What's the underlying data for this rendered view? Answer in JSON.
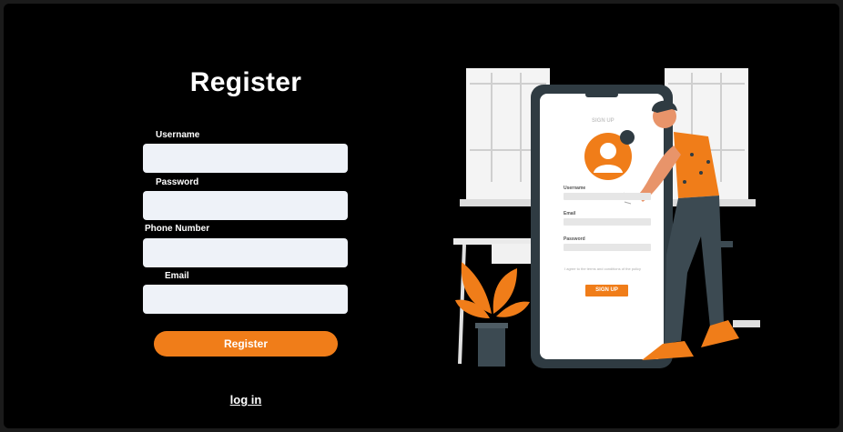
{
  "page_title": "Register",
  "form": {
    "fields": [
      {
        "label": "Username",
        "value": "",
        "placeholder": ""
      },
      {
        "label": "Password",
        "value": "",
        "placeholder": ""
      },
      {
        "label": "Phone Number",
        "value": "",
        "placeholder": ""
      },
      {
        "label": "Email",
        "value": "",
        "placeholder": ""
      }
    ],
    "submit_label": "Register",
    "login_link": "log in"
  },
  "illustration": {
    "phone_title": "SIGN UP",
    "phone_labels": [
      "Username",
      "Email",
      "Password"
    ],
    "phone_checkbox_text": "I agree to the terms and conditions of the policy",
    "phone_button": "SIGN UP"
  },
  "colors": {
    "accent": "#f07d19",
    "background": "#000000",
    "input_bg": "#eef2f8",
    "text": "#ffffff"
  }
}
